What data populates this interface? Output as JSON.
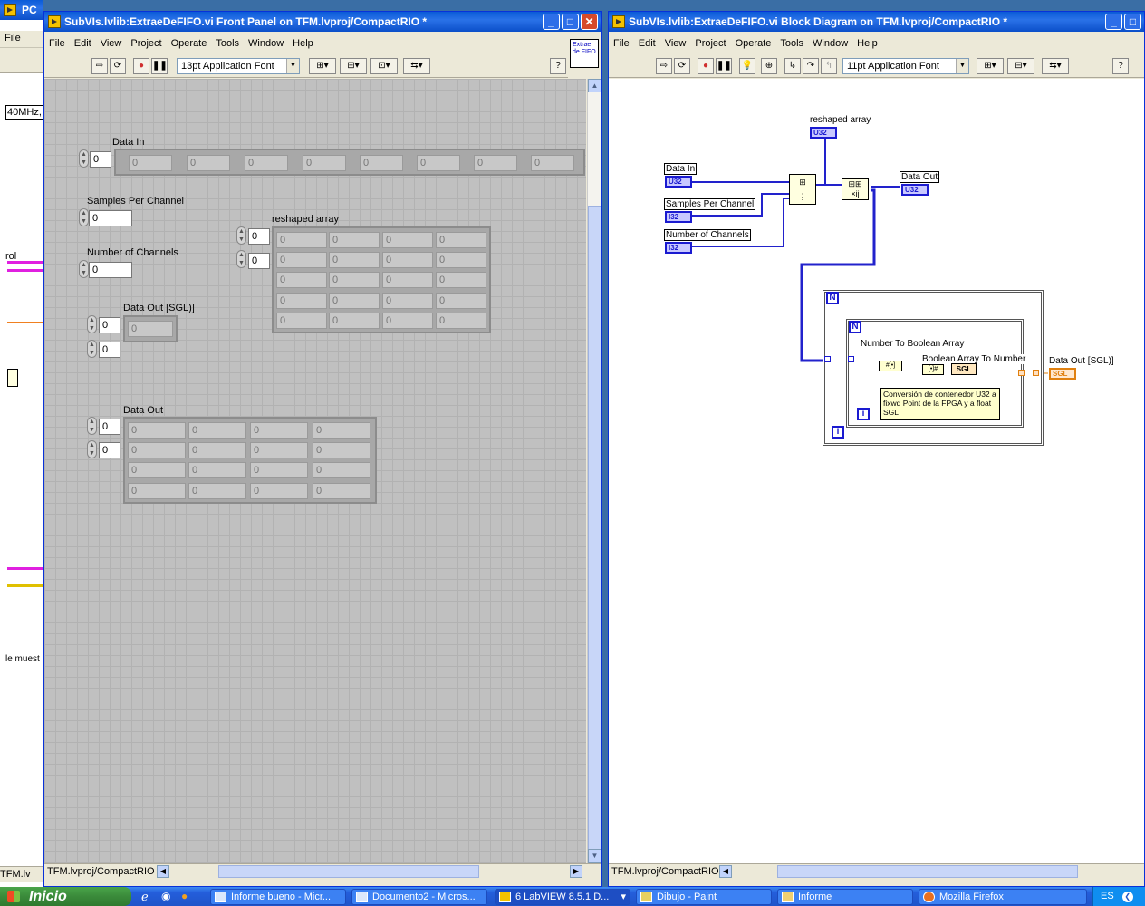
{
  "left_window": {
    "title_fragment": "PC",
    "menu_file": "File",
    "label_40mhz": "40MHz,",
    "label_rol": "rol",
    "label_muest": "le muest",
    "status": "TFM.lv"
  },
  "front_panel": {
    "title": "SubVIs.lvlib:ExtraeDeFIFO.vi Front Panel on TFM.lvproj/CompactRIO *",
    "menu": [
      "File",
      "Edit",
      "View",
      "Project",
      "Operate",
      "Tools",
      "Window",
      "Help"
    ],
    "font": "13pt Application Font",
    "icon_text": "Extrae de FIFO",
    "status": "TFM.lvproj/CompactRIO",
    "data_in": {
      "label": "Data In",
      "index": "0",
      "cells": [
        "0",
        "0",
        "0",
        "0",
        "0",
        "0",
        "0",
        "0"
      ]
    },
    "samples_per_channel": {
      "label": "Samples Per Channel",
      "value": "0"
    },
    "number_of_channels": {
      "label": "Number of Channels",
      "value": "0"
    },
    "reshaped_array": {
      "label": "reshaped array",
      "index_row": "0",
      "index_col": "0",
      "cells": [
        [
          "0",
          "0",
          "0",
          "0"
        ],
        [
          "0",
          "0",
          "0",
          "0"
        ],
        [
          "0",
          "0",
          "0",
          "0"
        ],
        [
          "0",
          "0",
          "0",
          "0"
        ],
        [
          "0",
          "0",
          "0",
          "0"
        ]
      ]
    },
    "data_out_sgl": {
      "label": "Data Out [SGL)]",
      "index_row": "0",
      "index_col": "0",
      "cell": "0"
    },
    "data_out": {
      "label": "Data Out",
      "index_row": "0",
      "index_col": "0",
      "cells": [
        [
          "0",
          "0",
          "0",
          "0"
        ],
        [
          "0",
          "0",
          "0",
          "0"
        ],
        [
          "0",
          "0",
          "0",
          "0"
        ],
        [
          "0",
          "0",
          "0",
          "0"
        ]
      ]
    }
  },
  "block_diagram": {
    "title": "SubVIs.lvlib:ExtraeDeFIFO.vi Block Diagram on TFM.lvproj/CompactRIO *",
    "menu": [
      "File",
      "Edit",
      "View",
      "Project",
      "Operate",
      "Tools",
      "Window",
      "Help"
    ],
    "font": "11pt Application Font",
    "status": "TFM.lvproj/CompactRIO",
    "reshaped_array": {
      "label": "reshaped array",
      "type": "U32"
    },
    "data_in": {
      "label": "Data In",
      "type": "U32"
    },
    "samples_per_channel": {
      "label": "Samples Per Channel",
      "type": "I32"
    },
    "number_of_channels": {
      "label": "Number of Channels",
      "type": "I32"
    },
    "data_out": {
      "label": "Data Out",
      "type": "U32"
    },
    "data_out_sgl": {
      "label": "Data Out [SGL)]",
      "type": "SGL"
    },
    "outer_loop_n": "N",
    "inner_loop_n": "N",
    "loop_i": "i",
    "number_to_boolean": "Number To Boolean Array",
    "boolean_to_number": "Boolean Array To Number",
    "sgl_node": "SGL",
    "comment": "Conversión de contenedor U32 a fixwd Point de la FPGA y a float SGL"
  },
  "taskbar": {
    "start": "Inicio",
    "tasks": [
      "Informe bueno - Micr...",
      "Documento2 - Micros...",
      "6 LabVIEW 8.5.1 D...",
      "Dibujo - Paint",
      "Informe",
      "Mozilla Firefox"
    ],
    "lang": "ES"
  }
}
